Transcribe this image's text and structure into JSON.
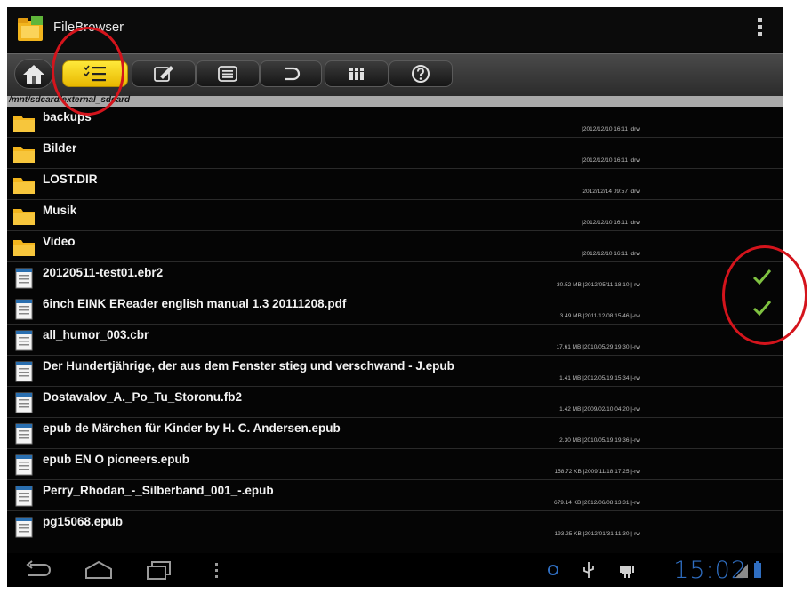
{
  "app": {
    "title": "FileBrowser"
  },
  "toolbar": {
    "buttons": [
      {
        "name": "home",
        "icon": "home-icon"
      },
      {
        "name": "multiselect",
        "icon": "checklist-icon",
        "active": true
      },
      {
        "name": "edit",
        "icon": "edit-icon"
      },
      {
        "name": "list",
        "icon": "list-icon"
      },
      {
        "name": "back",
        "icon": "undo-icon"
      },
      {
        "name": "grid",
        "icon": "grid-icon"
      },
      {
        "name": "help",
        "icon": "help-icon"
      }
    ],
    "active_color": "#f5d21a"
  },
  "path": "/mnt/sdcard/external_sdcard",
  "files": [
    {
      "name": "backups",
      "meta": "|2012/12/10 16:11 |drw",
      "type": "folder"
    },
    {
      "name": "Bilder",
      "meta": "|2012/12/10 16:11 |drw",
      "type": "folder"
    },
    {
      "name": "LOST.DIR",
      "meta": "|2012/12/14 09:57 |drw",
      "type": "folder"
    },
    {
      "name": "Musik",
      "meta": "|2012/12/10 16:11 |drw",
      "type": "folder"
    },
    {
      "name": "Video",
      "meta": "|2012/12/10 16:11 |drw",
      "type": "folder"
    },
    {
      "name": "20120511-test01.ebr2",
      "meta": "30.52 MB |2012/05/11 18:10 |-rw",
      "type": "file",
      "checked": true
    },
    {
      "name": "6inch EINK EReader english manual 1.3 20111208.pdf",
      "meta": "3.49 MB |2011/12/08 15:46 |-rw",
      "type": "file",
      "checked": true
    },
    {
      "name": "all_humor_003.cbr",
      "meta": "17.61 MB |2010/05/29 19:30 |-rw",
      "type": "file"
    },
    {
      "name": "Der Hundertjährige, der aus dem Fenster stieg und verschwand - J.epub",
      "meta": "1.41 MB |2012/05/19 15:34 |-rw",
      "type": "file"
    },
    {
      "name": "Dostavalov_A._Po_Tu_Storonu.fb2",
      "meta": "1.42 MB |2009/02/10 04:20 |-rw",
      "type": "file"
    },
    {
      "name": "epub de Märchen für Kinder by H. C. Andersen.epub",
      "meta": "2.30 MB |2010/05/19 19:36 |-rw",
      "type": "file"
    },
    {
      "name": "epub EN O pioneers.epub",
      "meta": "158.72 KB |2009/11/18 17:25 |-rw",
      "type": "file"
    },
    {
      "name": "Perry_Rhodan_-_Silberband_001_-.epub",
      "meta": "679.14 KB |2012/06/08 13:31 |-rw",
      "type": "file"
    },
    {
      "name": "pg15068.epub",
      "meta": "193.25 KB |2012/01/31 11:30 |-rw",
      "type": "file"
    }
  ],
  "statusbar": {
    "time": "15:02",
    "clock_color": "#2f6ec1"
  },
  "colors": {
    "folder": "#f2b51d",
    "check": "#7fc241",
    "annotation": "#d4141c"
  }
}
